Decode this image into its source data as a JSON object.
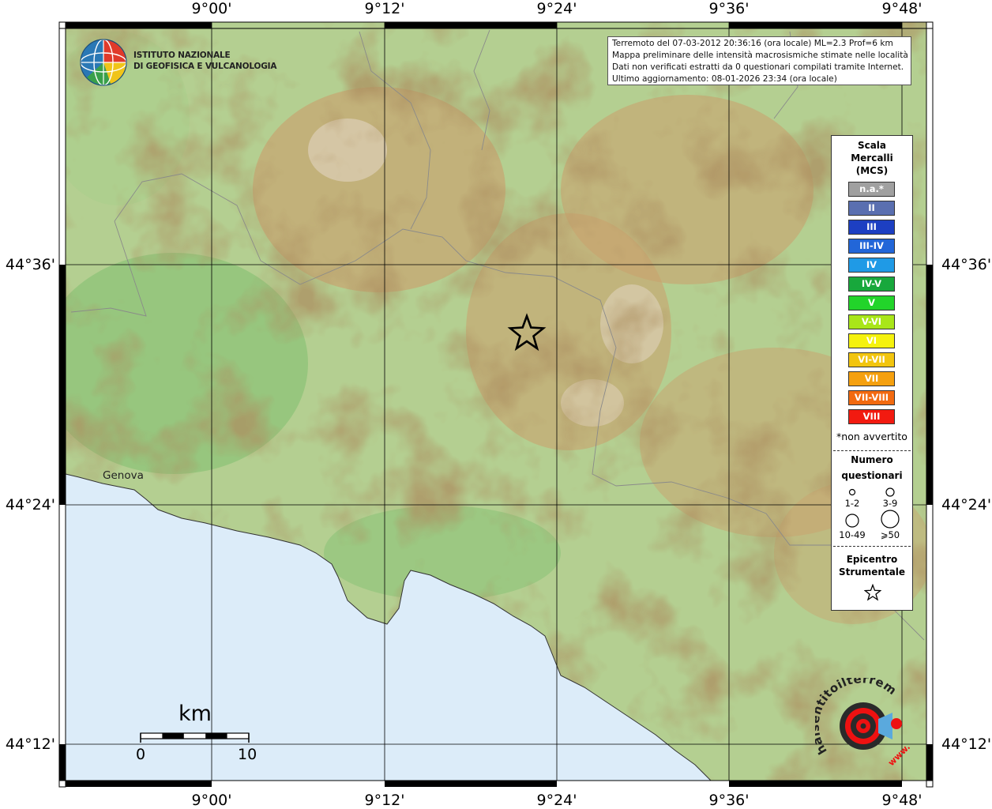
{
  "map": {
    "top_labels": [
      "9°00'",
      "9°12'",
      "9°24'",
      "9°36'",
      "9°48'"
    ],
    "bottom_labels": [
      "9°00'",
      "9°12'",
      "9°24'",
      "9°36'",
      "9°48'"
    ],
    "left_labels": [
      "44°36'",
      "44°24'",
      "44°12'"
    ],
    "right_labels": [
      "44°36'",
      "44°24'",
      "44°12'"
    ],
    "city": "Genova"
  },
  "institute": {
    "line1": "ISTITUTO NAZIONALE",
    "line2": "DI GEOFISICA E VULCANOLOGIA"
  },
  "info": {
    "line1": "Terremoto del 07-03-2012 20:36:16 (ora locale) ML=2.3 Prof=6 km",
    "line2": "Mappa preliminare delle intensità macrosismiche stimate nelle località",
    "line3": "Dati non verificati estratti da 0 questionari compilati tramite Internet.",
    "line4": "Ultimo aggiornamento: 08-01-2026 23:34 (ora locale)"
  },
  "legend": {
    "title1": "Scala",
    "title2": "Mercalli",
    "title3": "(MCS)",
    "scale": [
      {
        "label": "n.a.*",
        "color": "#a0a0a0"
      },
      {
        "label": "II",
        "color": "#5a6fb0"
      },
      {
        "label": "III",
        "color": "#1d3fc2"
      },
      {
        "label": "III-IV",
        "color": "#2266d8"
      },
      {
        "label": "IV",
        "color": "#1f9ae6"
      },
      {
        "label": "IV-V",
        "color": "#18a83c"
      },
      {
        "label": "V",
        "color": "#22d42a"
      },
      {
        "label": "V-VI",
        "color": "#a9e619"
      },
      {
        "label": "VI",
        "color": "#f5f20e"
      },
      {
        "label": "VI-VII",
        "color": "#f2c50f"
      },
      {
        "label": "VII",
        "color": "#f5a00f"
      },
      {
        "label": "VII-VIII",
        "color": "#f26a10"
      },
      {
        "label": "VIII",
        "color": "#f21a10"
      }
    ],
    "note": "*non avvertito",
    "count_title1": "Numero",
    "count_title2": "questionari",
    "counts": [
      "1-2",
      "3-9",
      "10-49",
      "⩾50"
    ],
    "epi_title1": "Epicentro",
    "epi_title2": "Strumentale"
  },
  "scalebar": {
    "unit": "km",
    "start": "0",
    "end": "10"
  },
  "brand": {
    "text": "haisentitoilterremoto.it",
    "www": "www."
  },
  "colors": {
    "sea": "#dcecf9",
    "lowland": "#9ecb86",
    "hills": "#dccf9a",
    "mountains": "#b88a5a",
    "peaks": "#e8d8cc",
    "grid": "#000000"
  }
}
